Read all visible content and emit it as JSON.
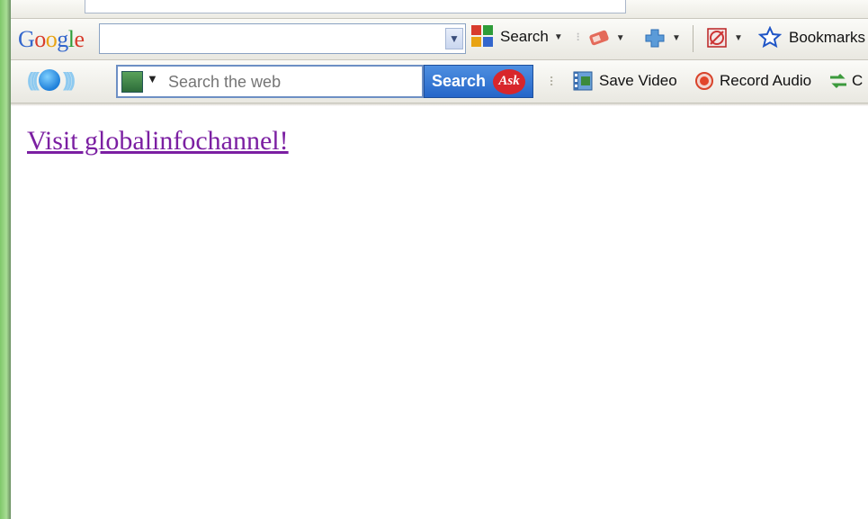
{
  "google_toolbar": {
    "logo_letters": [
      "G",
      "o",
      "o",
      "g",
      "l",
      "e"
    ],
    "search_value": "",
    "search_label": "Search",
    "bookmarks_label": "Bookmarks"
  },
  "ask_toolbar": {
    "search_placeholder": "Search the web",
    "search_button_label": "Search",
    "ask_logo": "Ask",
    "save_video_label": "Save Video",
    "record_audio_label": "Record Audio",
    "cut_off_label": "C"
  },
  "content": {
    "link_text": "Visit globalinfochannel!",
    "link_color": "#7b1fa2"
  },
  "icons": {
    "google_multicolor": "google-apps-icon",
    "highlighter": "highlighter-icon",
    "puzzle": "puzzle-icon",
    "pagerank": "pagerank-icon",
    "star": "star-icon",
    "save_video": "film-icon",
    "record_audio": "record-icon"
  }
}
